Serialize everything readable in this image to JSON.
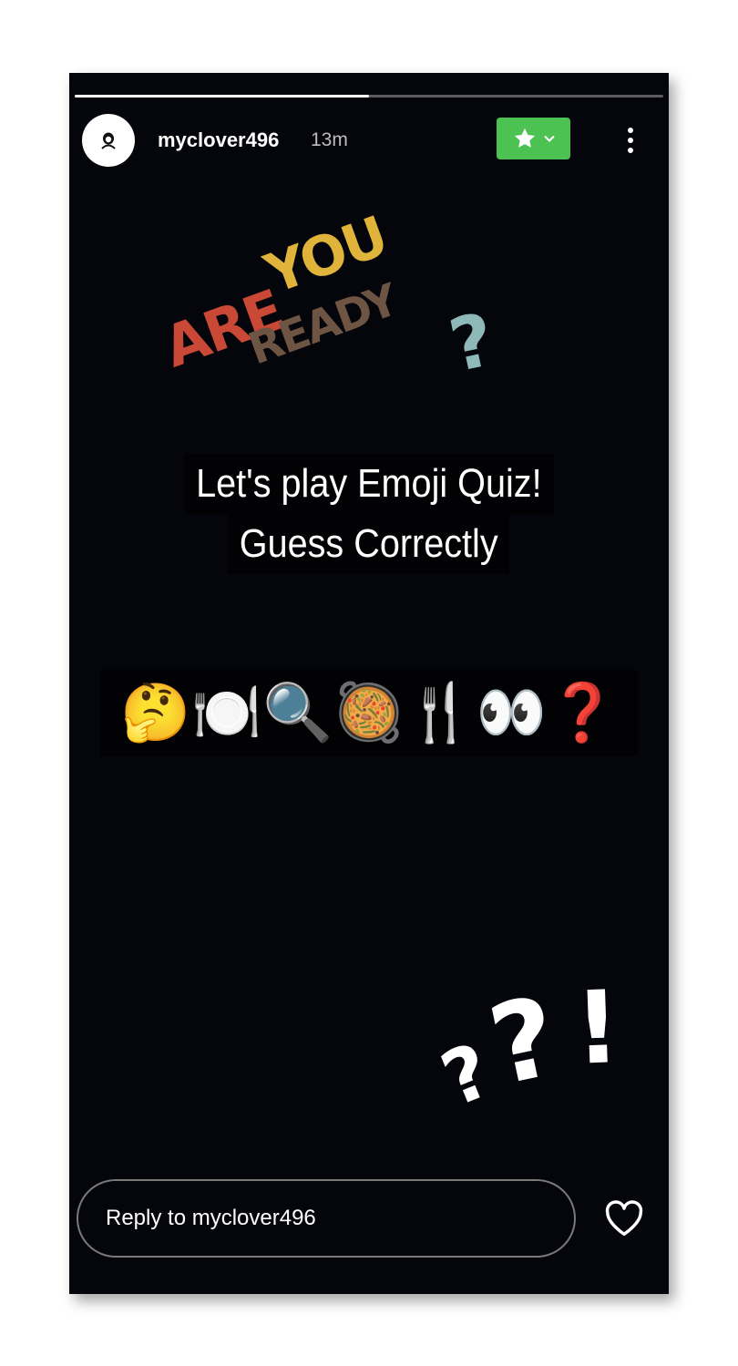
{
  "story": {
    "progress": 0.5,
    "author": {
      "username": "myclover496",
      "time_ago": "13m",
      "avatar_icon": "avatar-icon"
    },
    "favorite_button": {
      "icons": [
        "star-icon",
        "chevron-down-icon"
      ],
      "color": "#4cc252"
    },
    "more_button": {
      "icon": "more-vertical-icon"
    },
    "sticker": {
      "words": [
        "ARE",
        "YOU",
        "READY",
        "?"
      ],
      "colors": [
        "#c94836",
        "#e0b43a",
        "#6e5443",
        "#8fb9b9"
      ]
    },
    "quiz_text": {
      "line1": "Let's play Emoji Quiz!",
      "line2": "Guess Correctly"
    },
    "emoji_clue": [
      "🤔",
      "🍽️",
      "🔍",
      "🥘",
      "🍴",
      "👀",
      "❓"
    ],
    "end_marks": [
      "?",
      "?",
      "!"
    ]
  },
  "reply": {
    "placeholder": "Reply to myclover496",
    "like_icon": "heart-icon"
  },
  "colors": {
    "background": "#05050c",
    "accent": "#4cc252",
    "text": "#ffffff"
  }
}
